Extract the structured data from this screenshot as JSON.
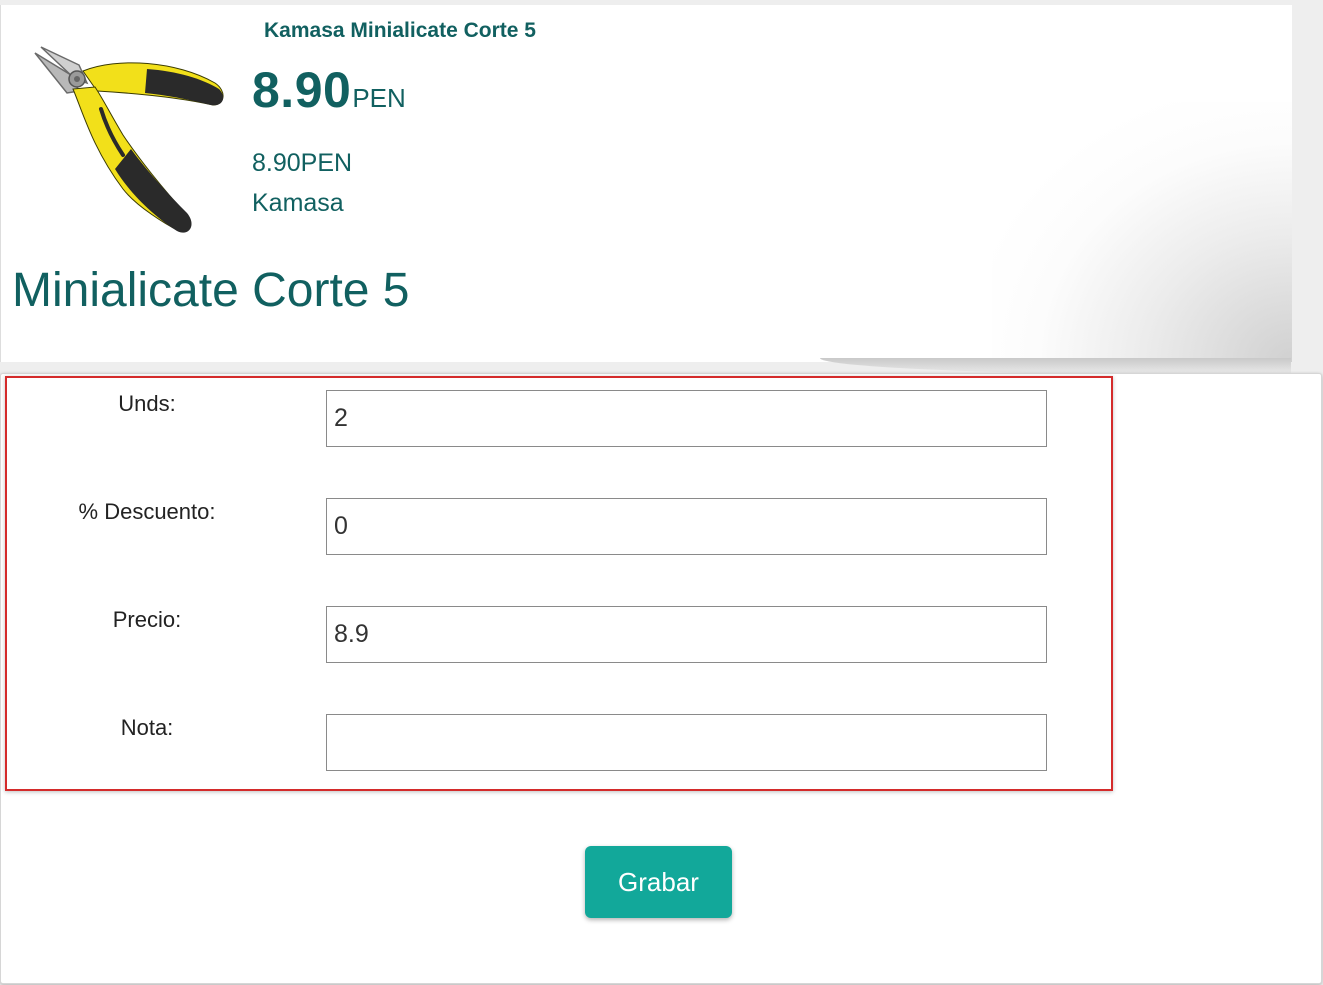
{
  "product": {
    "header_name": "Kamasa Minialicate Corte 5",
    "price_amount": "8.90",
    "price_currency": "PEN",
    "price_full": "8.90PEN",
    "brand": "Kamasa",
    "title": "Minialicate Corte 5",
    "image_icon": "pliers-icon"
  },
  "form": {
    "units": {
      "label": "Unds:",
      "value": "2"
    },
    "discount": {
      "label": "% Descuento:",
      "value": "0"
    },
    "price": {
      "label": "Precio:",
      "value": "8.9"
    },
    "note": {
      "label": "Nota:",
      "value": ""
    },
    "save_label": "Grabar"
  },
  "colors": {
    "text_teal": "#116060",
    "button": "#12a89a",
    "highlight_border": "#d42b2b"
  }
}
